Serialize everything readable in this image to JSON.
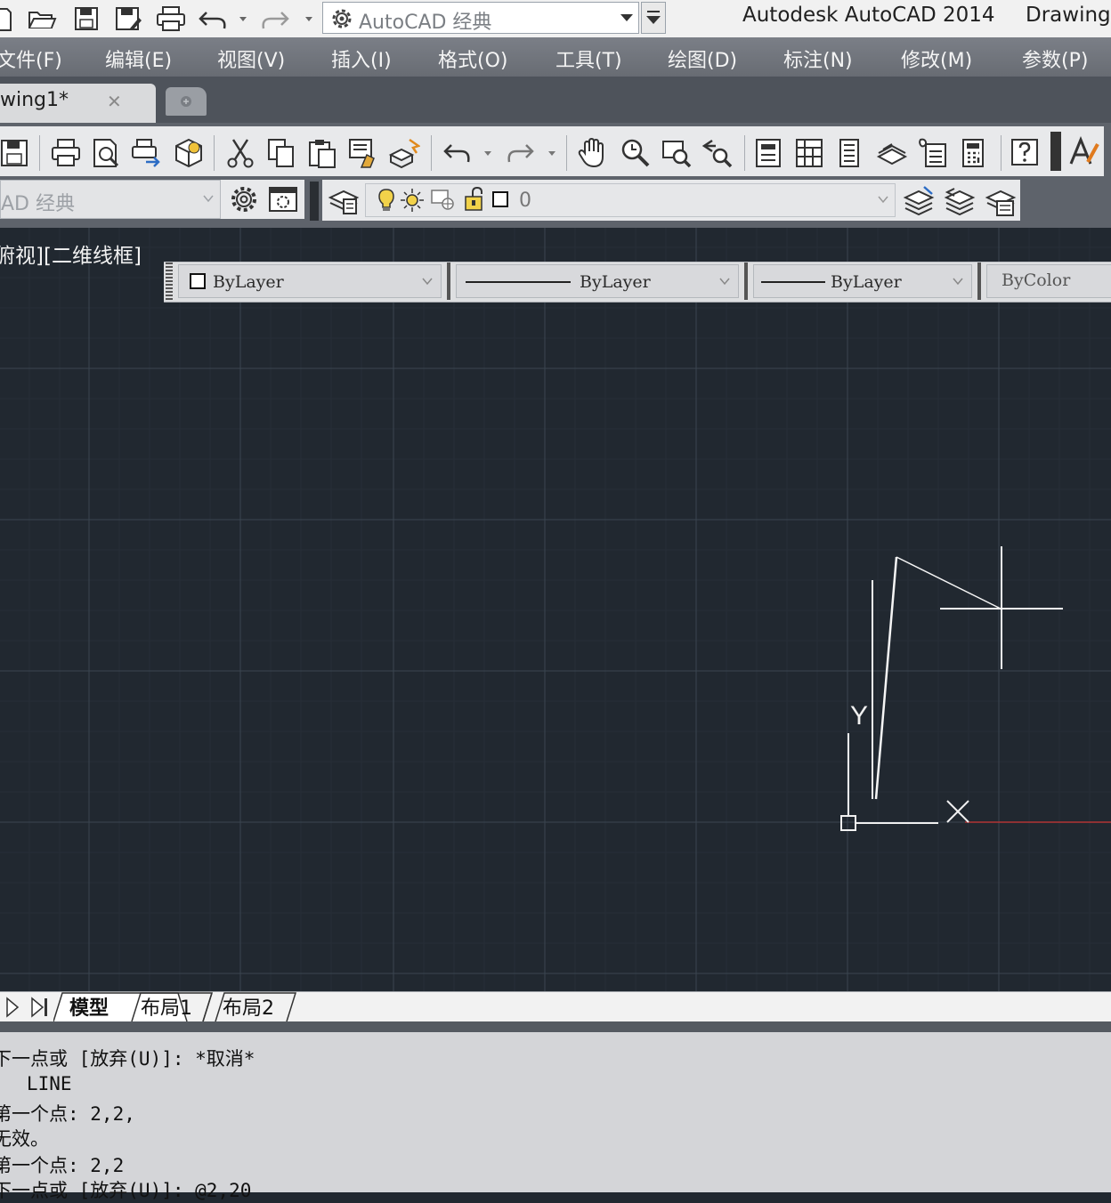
{
  "titlebar": {
    "workspace": "AutoCAD 经典",
    "app_title": "Autodesk AutoCAD 2014",
    "doc_title": "Drawing"
  },
  "menu": [
    "文件(F)",
    "编辑(E)",
    "视图(V)",
    "插入(I)",
    "格式(O)",
    "工具(T)",
    "绘图(D)",
    "标注(N)",
    "修改(M)",
    "参数(P)"
  ],
  "tabs": {
    "doc_tab_label": "wing1*",
    "close_glyph": "✕"
  },
  "layers_toolbar": {
    "workspace_partial": "AD 经典",
    "current_layer": "0"
  },
  "viewport": {
    "label": "俯视][二维线框]"
  },
  "properties": {
    "color": "ByLayer",
    "linetype": "ByLayer",
    "lineweight": "ByLayer",
    "plotstyle": "ByColor"
  },
  "ucs": {
    "y_label": "Y"
  },
  "layout_tabs": [
    "模型",
    "布局1",
    "布局2"
  ],
  "command_history": [
    "下一点或 [放弃(U)]: *取消*",
    "   LINE",
    "第一个点: 2,2,",
    "无效。",
    "第一个点: 2,2",
    "下一点或 [放弃(U)]: @2,20"
  ],
  "colors": {
    "canvas_bg": "#212830",
    "grid_major": "#3a4550",
    "x_axis": "#b33434"
  }
}
